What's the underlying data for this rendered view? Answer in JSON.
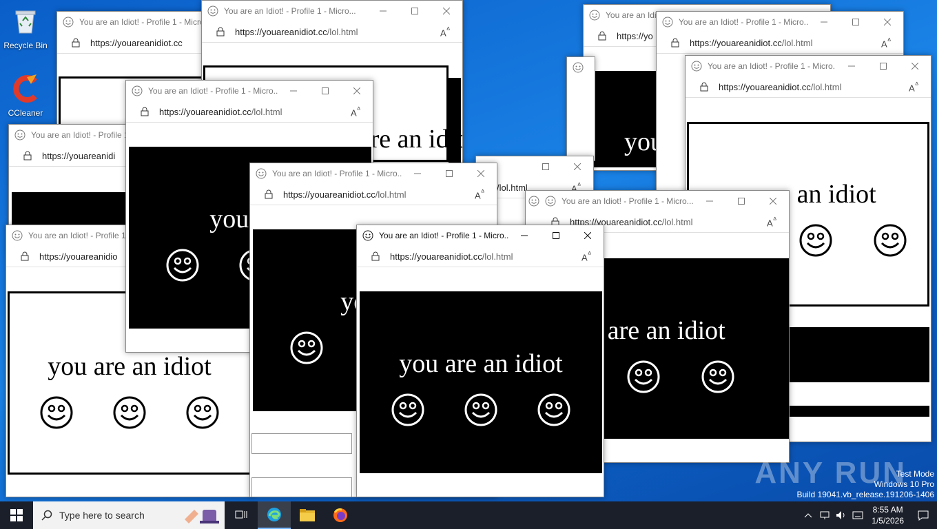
{
  "desktop": {
    "icons": [
      {
        "label": "Recycle Bin",
        "icon": "recycle-bin-icon"
      },
      {
        "label": "CCleaner",
        "icon": "ccleaner-icon"
      }
    ]
  },
  "window": {
    "title_full": "You are an Idiot! - Profile 1 - Micro...",
    "title_short": "You are an Idiot! - Profile 1",
    "title_tiny": "You are an Idio",
    "url_host": "https://youareanidiot.cc",
    "url_path": "/lol.html",
    "url_cut1": "https://youareanidi",
    "url_cut2": "https://youareanidio",
    "url_cut3": "https://yo",
    "message": "you are an idiot"
  },
  "taskbar": {
    "search_placeholder": "Type here to search",
    "apps": [
      "task-view-icon",
      "edge-icon",
      "file-explorer-icon",
      "firefox-icon"
    ],
    "time": "8:55 AM",
    "date": "1/5/2026"
  },
  "watermark": {
    "line1": "Test Mode",
    "line2": "Windows 10 Pro",
    "line3": "Build 19041.vb_release.191206-1406",
    "brand": "ANY RUN"
  }
}
